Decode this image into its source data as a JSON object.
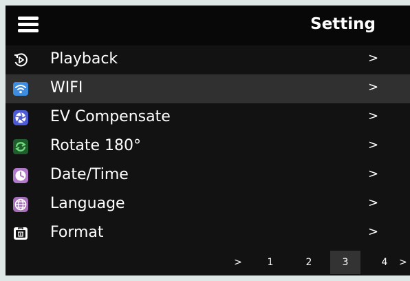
{
  "header": {
    "title": "Setting",
    "menu_icon": "hamburger-menu-icon"
  },
  "menu": {
    "selected_index": 1,
    "items": [
      {
        "label": "Playback",
        "chevron": ">",
        "icon": "playback-icon"
      },
      {
        "label": "WIFI",
        "chevron": ">",
        "icon": "wifi-icon"
      },
      {
        "label": "EV Compensate",
        "chevron": ">",
        "icon": "ev-compensate-icon"
      },
      {
        "label": "Rotate 180°",
        "chevron": ">",
        "icon": "rotate-icon"
      },
      {
        "label": "Date/Time",
        "chevron": ">",
        "icon": "clock-icon"
      },
      {
        "label": "Language",
        "chevron": ">",
        "icon": "globe-icon"
      },
      {
        "label": "Format",
        "chevron": ">",
        "icon": "format-icon"
      }
    ]
  },
  "pagination": {
    "prev": ">",
    "pages": [
      "1",
      "2",
      "3",
      "4"
    ],
    "current": "3",
    "next": ">"
  },
  "colors": {
    "background": "#121212",
    "header": "#080808",
    "selected_row": "#303030",
    "wifi_icon": "#3d8ee0",
    "ev_icon": "#4e5bd6",
    "rotate_icon": "#2f9a46",
    "clock_icon": "#b07ac9",
    "globe_icon": "#a76fb9"
  }
}
